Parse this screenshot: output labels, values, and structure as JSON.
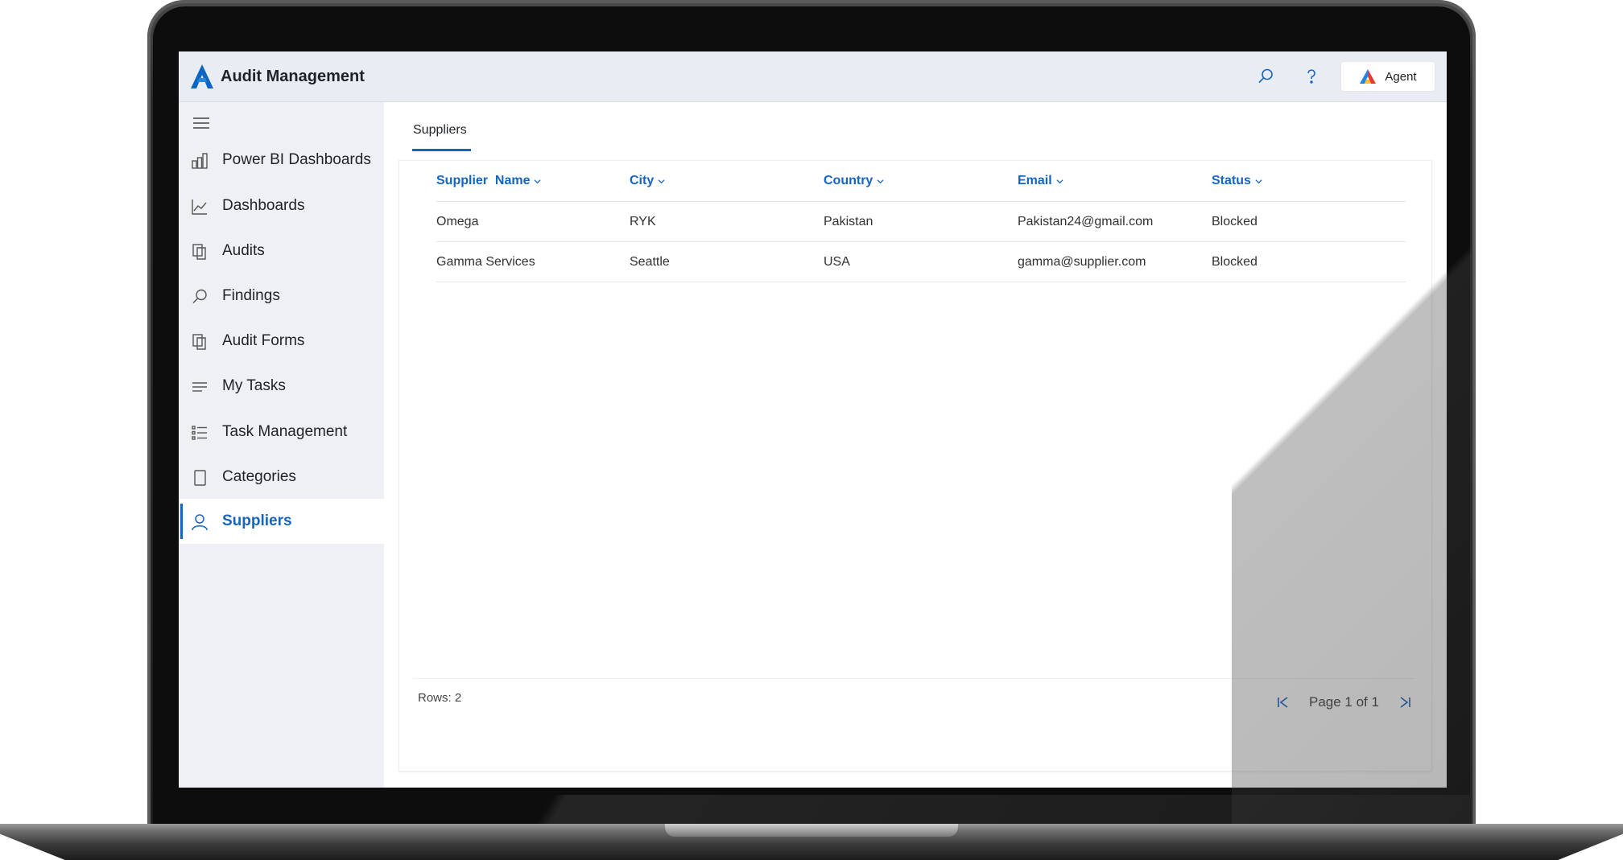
{
  "app": {
    "title": "Audit Management",
    "agent_label": "Agent",
    "accent_color": "#1565c0"
  },
  "topbar": {
    "icons": [
      "search-icon",
      "help-icon"
    ]
  },
  "sidebar": {
    "items": [
      {
        "label": "Power BI Dashboards",
        "icon": "bar-chart-icon"
      },
      {
        "label": "Dashboards",
        "icon": "line-chart-icon"
      },
      {
        "label": "Audits",
        "icon": "documents-icon"
      },
      {
        "label": "Findings",
        "icon": "search-icon"
      },
      {
        "label": "Audit Forms",
        "icon": "documents-icon"
      },
      {
        "label": "My Tasks",
        "icon": "lines-icon"
      },
      {
        "label": "Task Management",
        "icon": "checklist-icon"
      },
      {
        "label": "Categories",
        "icon": "page-icon"
      },
      {
        "label": "Suppliers",
        "icon": "person-icon",
        "active": true
      }
    ]
  },
  "main": {
    "tab_label": "Suppliers",
    "columns": [
      "Supplier  Name",
      "City",
      "Country",
      "Email",
      "Status"
    ],
    "rows": [
      {
        "name": "Omega",
        "city": "RYK",
        "country": "Pakistan",
        "email": "Pakistan24@gmail.com",
        "status": "Blocked"
      },
      {
        "name": "Gamma Services",
        "city": "Seattle",
        "country": "USA",
        "email": "gamma@supplier.com",
        "status": "Blocked"
      }
    ],
    "rows_count": "Rows: 2",
    "page_text": "Page 1 of 1"
  }
}
